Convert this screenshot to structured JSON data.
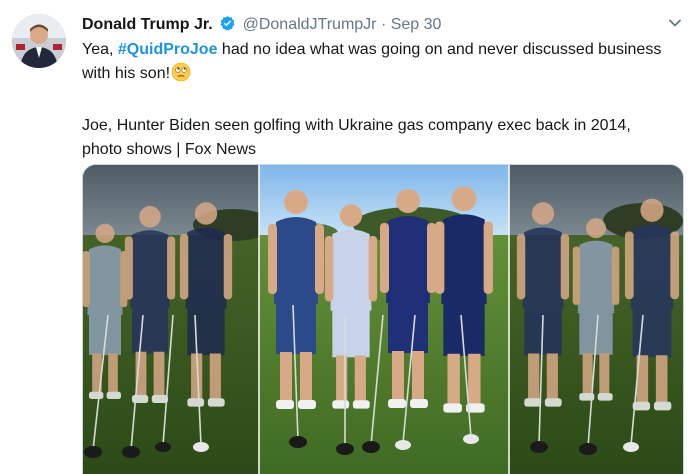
{
  "author": {
    "display_name": "Donald Trump Jr.",
    "handle": "@DonaldJTrumpJr",
    "separator": "·",
    "date": "Sep 30",
    "verified": true
  },
  "tweet": {
    "text_before": "Yea, ",
    "hashtag": "#QuidProJoe",
    "text_after": " had no idea what was going on and never discussed business with his son!",
    "emoji": "face-with-rolling-eyes",
    "paragraph2": "Joe, Hunter Biden seen golfing with Ukraine gas company exec back in 2014, photo shows | Fox News"
  },
  "media": {
    "description_icon": "photo-of-four-men-golfing"
  },
  "icons": {
    "verified": "verified-badge-icon",
    "caret": "chevron-down-icon"
  },
  "colors": {
    "link": "#1b95e0",
    "verified": "#1da1f2",
    "muted": "#657786"
  }
}
